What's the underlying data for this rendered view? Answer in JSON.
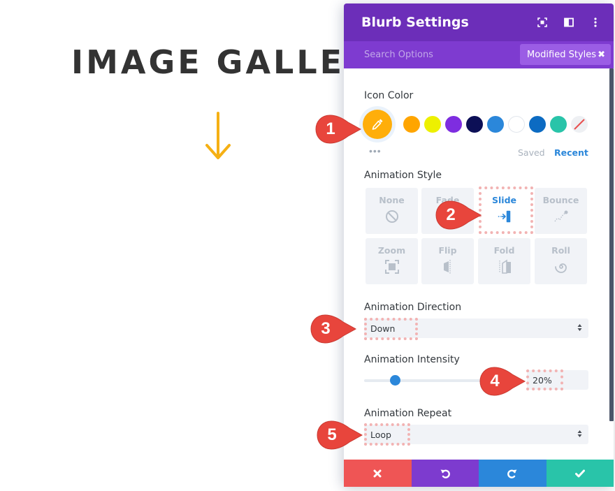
{
  "page": {
    "heading": "IMAGE GALLERY",
    "arrow_color": "#f5b014"
  },
  "panel": {
    "title": "Blurb Settings",
    "header_icons": [
      "fullscreen-icon",
      "split-view-icon",
      "more-options-icon"
    ],
    "search_placeholder": "Search Options",
    "modified_styles_label": "Modified Styles",
    "colors": {
      "header_bg": "#6c2eb9",
      "search_bg": "#7e3bd0",
      "accent_blue": "#2b87da"
    }
  },
  "icon_color": {
    "label": "Icon Color",
    "selected_color": "#ffae0a",
    "swatches": [
      {
        "name": "orange",
        "hex": "#ffa500"
      },
      {
        "name": "yellow",
        "hex": "#edf000"
      },
      {
        "name": "purple",
        "hex": "#7e2de0"
      },
      {
        "name": "navy",
        "hex": "#0c0f56"
      },
      {
        "name": "blue",
        "hex": "#2b87da"
      },
      {
        "name": "white",
        "hex": "#ffffff"
      },
      {
        "name": "dark-blue",
        "hex": "#0c6bc2"
      },
      {
        "name": "teal",
        "hex": "#29c4a9"
      },
      {
        "name": "none",
        "hex": "transparent"
      }
    ],
    "more_label": "•••",
    "saved_label": "Saved",
    "recent_label": "Recent"
  },
  "animation_style": {
    "label": "Animation Style",
    "options": [
      {
        "label": "None",
        "icon": "none-icon"
      },
      {
        "label": "Fade",
        "icon": "fade-icon"
      },
      {
        "label": "Slide",
        "icon": "slide-icon"
      },
      {
        "label": "Bounce",
        "icon": "bounce-icon"
      },
      {
        "label": "Zoom",
        "icon": "zoom-icon"
      },
      {
        "label": "Flip",
        "icon": "flip-icon"
      },
      {
        "label": "Fold",
        "icon": "fold-icon"
      },
      {
        "label": "Roll",
        "icon": "roll-icon"
      }
    ],
    "selected": "Slide"
  },
  "animation_direction": {
    "label": "Animation Direction",
    "value": "Down"
  },
  "animation_intensity": {
    "label": "Animation Intensity",
    "value_text": "20%",
    "value_percent": 20
  },
  "animation_repeat": {
    "label": "Animation Repeat",
    "value": "Loop"
  },
  "footer": {
    "buttons": [
      {
        "name": "discard",
        "icon": "close-icon",
        "color": "#ef5555"
      },
      {
        "name": "undo",
        "icon": "undo-icon",
        "color": "#7d3bcf"
      },
      {
        "name": "redo",
        "icon": "redo-icon",
        "color": "#2b87da"
      },
      {
        "name": "save",
        "icon": "check-icon",
        "color": "#29c4a9"
      }
    ]
  },
  "callouts": [
    "1",
    "2",
    "3",
    "4",
    "5"
  ],
  "callout_color": "#e8453c"
}
